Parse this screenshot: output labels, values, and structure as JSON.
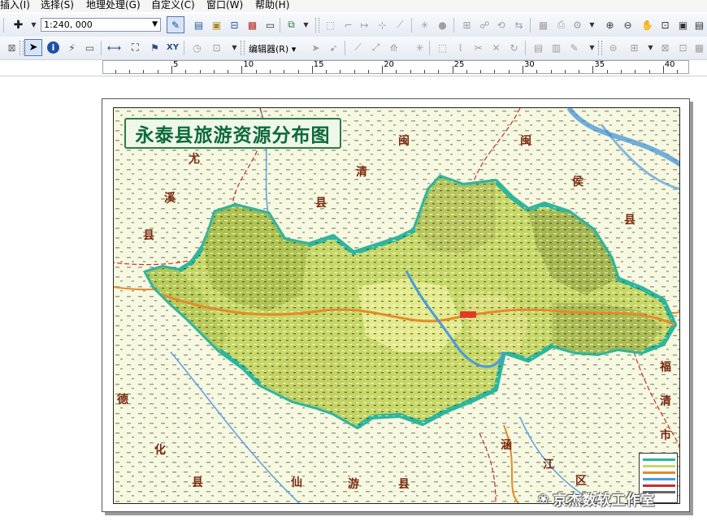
{
  "menu": {
    "items": [
      "插入(I)",
      "选择(S)",
      "地理处理(G)",
      "自定义(C)",
      "窗口(W)",
      "帮助(H)"
    ]
  },
  "toolbar1": {
    "scale_value": "1:240, 000",
    "icons": [
      "add-data-icon",
      "draw-rect-icon",
      "table-icon",
      "catalog-icon",
      "toolbox-icon",
      "python-icon",
      "model-icon",
      "layer-icon",
      "topology-icon",
      "edit-vertex-icon",
      "georef-icon",
      "print-icon",
      "zoom-page-icon",
      "full-extent-icon"
    ]
  },
  "toolbar2": {
    "editor_label": "编辑器(R)",
    "identify_label": "i",
    "xy_label": "XY"
  },
  "ruler": {
    "labels": [
      "5",
      "10",
      "15",
      "20",
      "25",
      "30",
      "35",
      "40"
    ]
  },
  "map": {
    "title": "永泰县旅游资源分布图",
    "region_labels": {
      "you": "尤",
      "xi": "溪",
      "xian_left": "县",
      "min": "闽",
      "qing": "清",
      "xian_mid": "县",
      "min2": "闽",
      "hou": "侯",
      "xian_right": "县",
      "fu": "福",
      "qing2": "清",
      "shi": "市",
      "de": "德",
      "hua": "化",
      "xian_bl": "县",
      "xian_title": "仙",
      "you2": "游",
      "xian_b2": "县",
      "han": "涵",
      "jiang": "江",
      "qu": "区"
    }
  },
  "watermark": {
    "text": "京杰数软工作室"
  },
  "colors": {
    "county_fill": "#c8d86a",
    "county_border": "#2fb59a",
    "outside": "#f7f9e4",
    "title_text": "#0c6a3a"
  }
}
